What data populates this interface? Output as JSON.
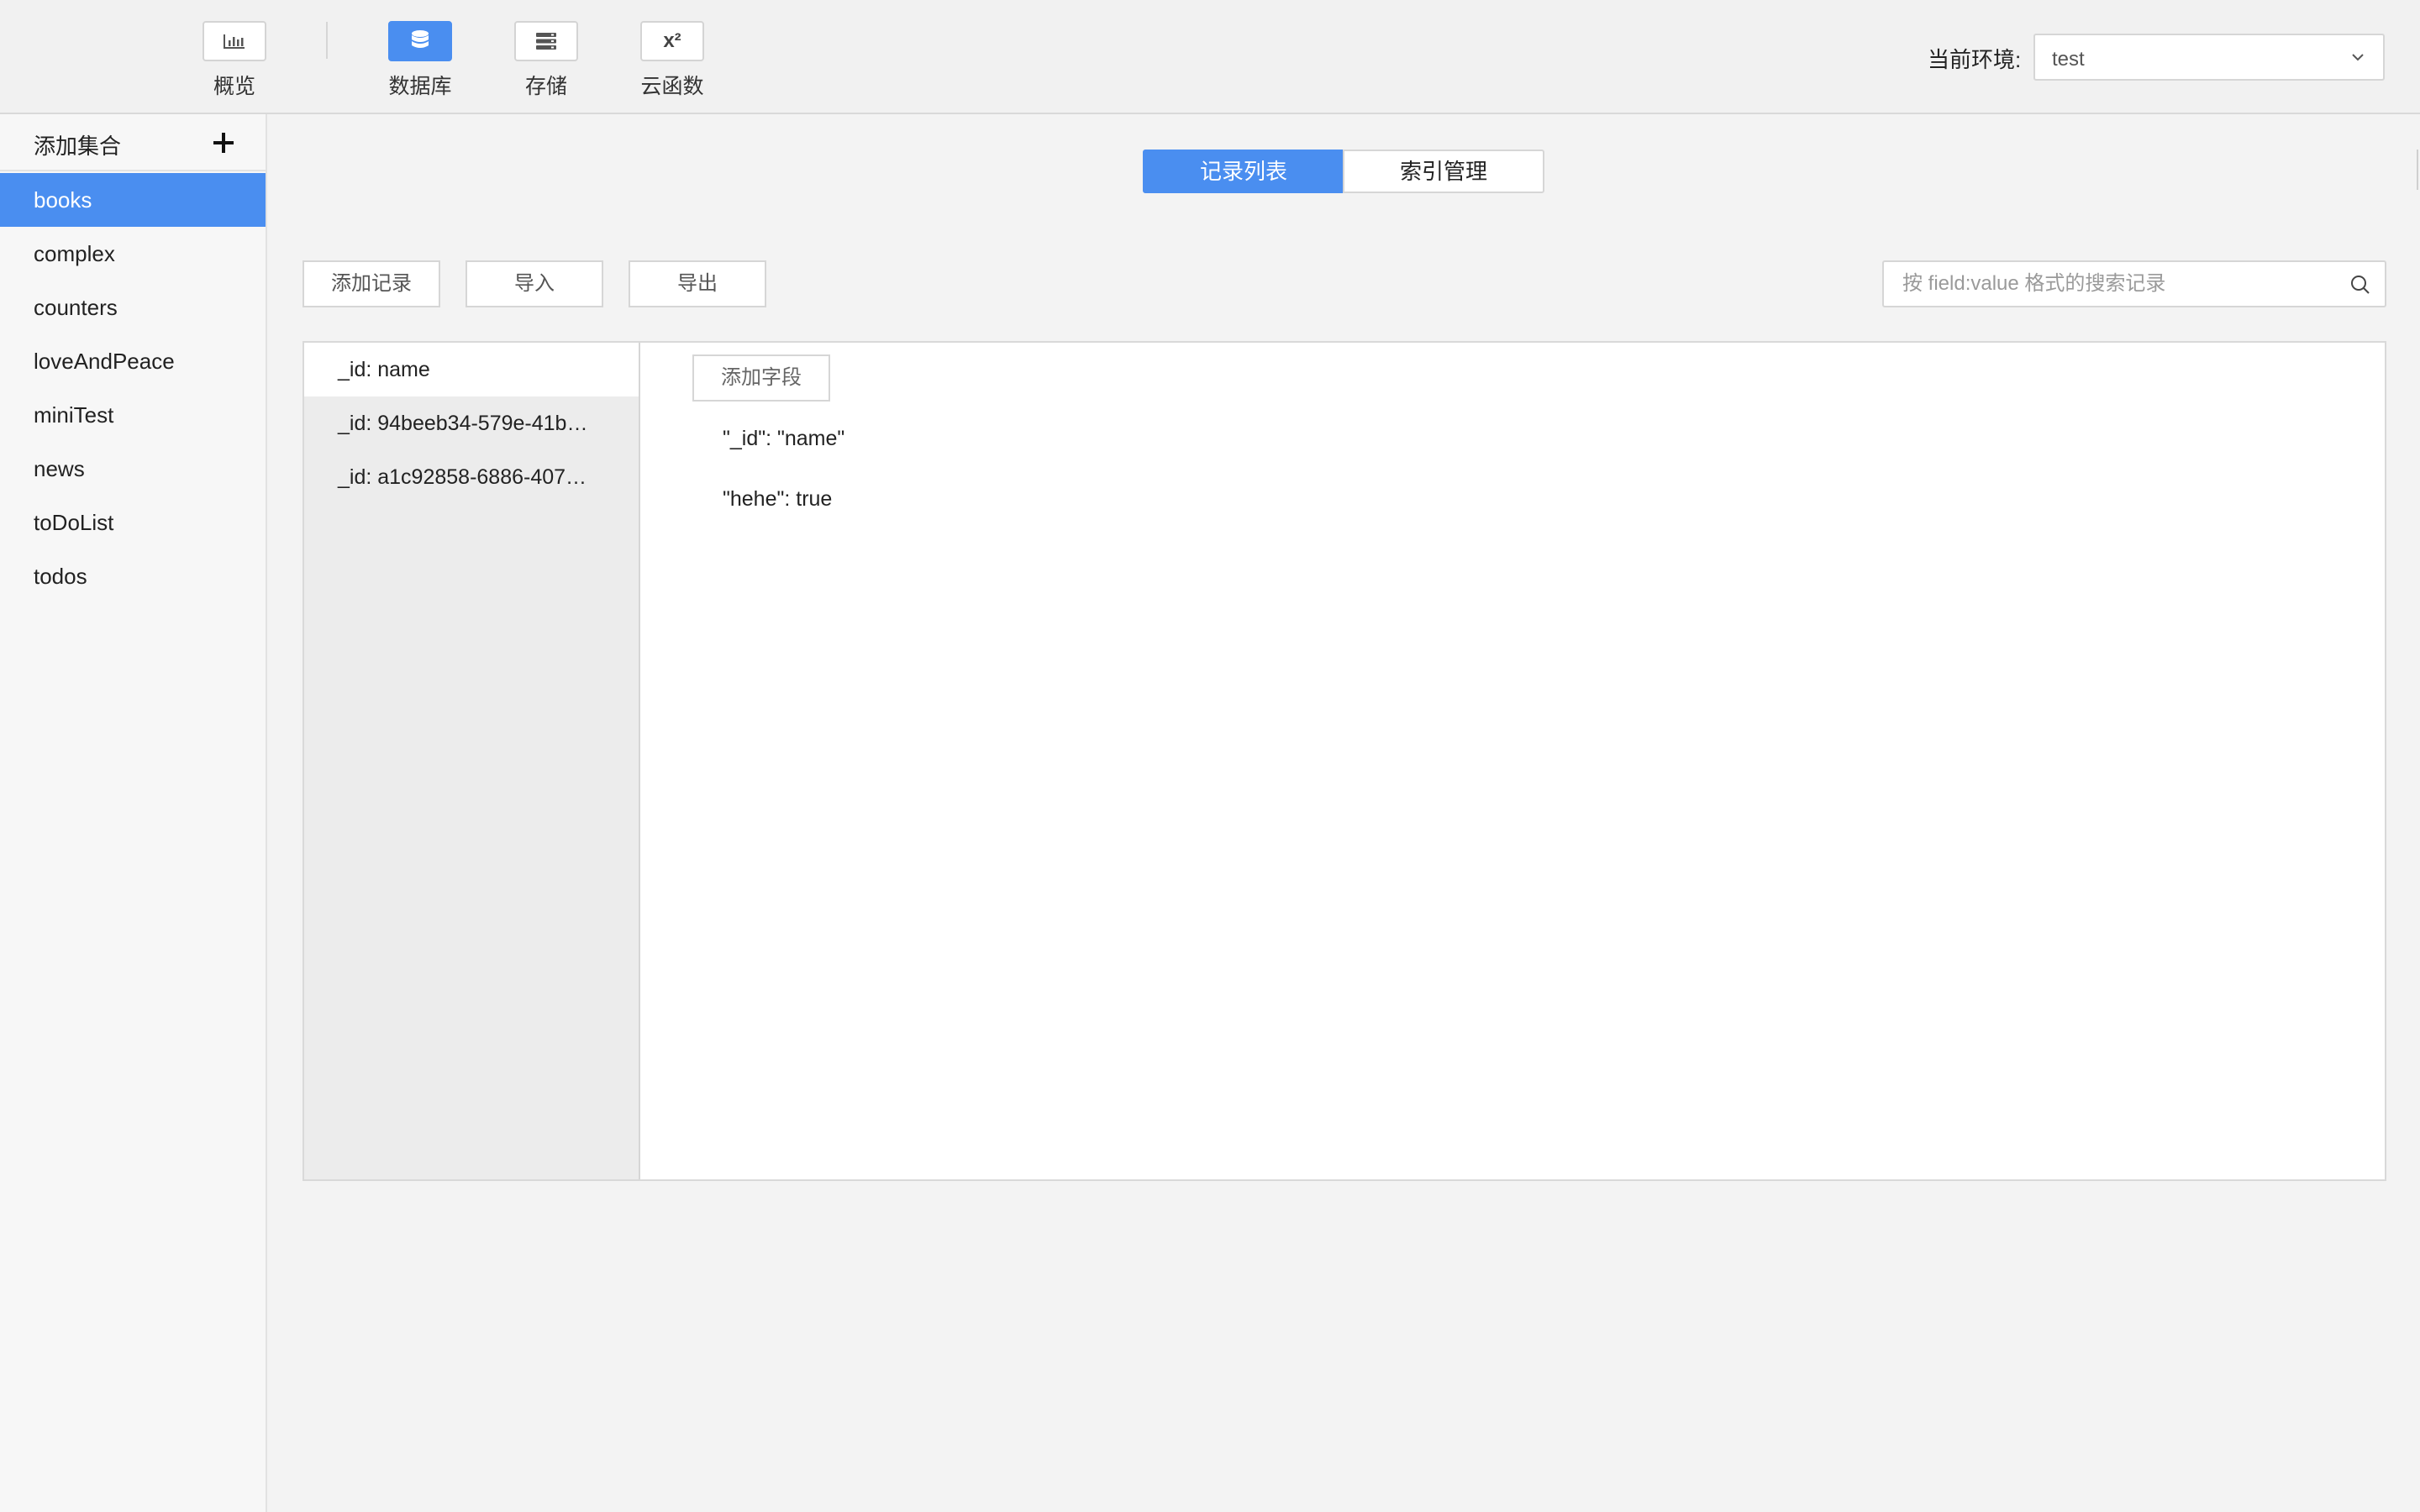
{
  "nav": {
    "items": [
      {
        "label": "概览",
        "icon": "bar-chart-icon"
      },
      {
        "label": "数据库",
        "icon": "database-icon"
      },
      {
        "label": "存储",
        "icon": "storage-icon"
      },
      {
        "label": "云函数",
        "icon": "function-icon"
      }
    ],
    "function_icon_text": "x²",
    "env_label": "当前环境:",
    "env_value": "test"
  },
  "sidebar": {
    "add_label": "添加集合",
    "collections": [
      "books",
      "complex",
      "counters",
      "loveAndPeace",
      "miniTest",
      "news",
      "toDoList",
      "todos"
    ],
    "active_index": 0
  },
  "tabs": [
    "记录列表",
    "索引管理"
  ],
  "toolbar": {
    "add_record": "添加记录",
    "import": "导入",
    "export": "导出",
    "search_placeholder": "按 field:value 格式的搜索记录"
  },
  "records": [
    "_id: name",
    "_id: 94beeb34-579e-41b…",
    "_id: a1c92858-6886-407…"
  ],
  "detail": {
    "add_field": "添加字段",
    "fields": [
      "\"_id\": \"name\"",
      "\"hehe\": true"
    ]
  },
  "colors": {
    "accent": "#4a8ef0",
    "sidebar_bg": "#f7f7f7",
    "list_bg": "#ececec"
  }
}
